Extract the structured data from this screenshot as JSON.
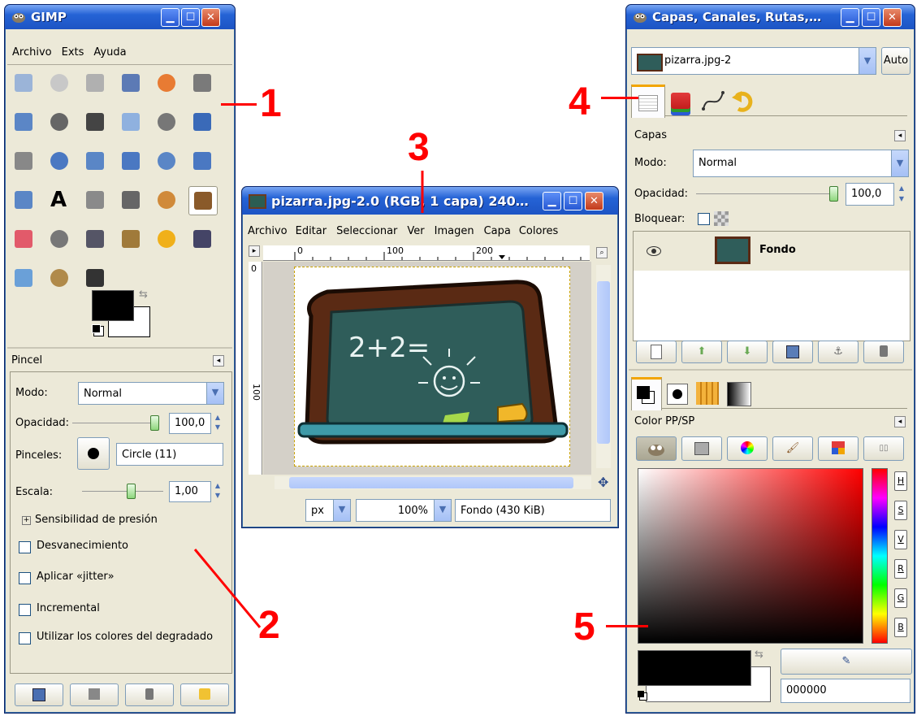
{
  "toolbox": {
    "title": "GIMP",
    "menu": [
      "Archivo",
      "Exts",
      "Ayuda"
    ],
    "tools": [
      "rect-select",
      "ellipse-select",
      "free-select",
      "fuzzy-select",
      "color-select",
      "scissors",
      "foreground-select",
      "paths",
      "color-picker",
      "zoom",
      "measure",
      "move",
      "align",
      "crop",
      "rotate",
      "scale",
      "shear",
      "perspective",
      "flip",
      "text",
      "bucket-fill",
      "blend",
      "pencil",
      "paintbrush",
      "eraser",
      "airbrush",
      "ink",
      "clone",
      "heal",
      "perspective-clone",
      "blur",
      "smudge",
      "dodge-burn"
    ],
    "fg_color": "#000000",
    "bg_color": "#ffffff"
  },
  "tool_options": {
    "title": "Pincel",
    "mode_label": "Modo:",
    "mode_value": "Normal",
    "opacity_label": "Opacidad:",
    "opacity_value": "100,0",
    "opacity_level": 1.0,
    "brushes_label": "Pinceles:",
    "brush_name": "Circle (11)",
    "scale_label": "Escala:",
    "scale_value": "1,00",
    "pressure": "Sensibilidad de presión",
    "checks": [
      "Desvanecimiento",
      "Aplicar «jitter»",
      "Incremental",
      "Utilizar los colores del degradado"
    ]
  },
  "image_window": {
    "title": "pizarra.jpg-2.0 (RGB, 1 capa) 240…",
    "menu": [
      "Archivo",
      "Editar",
      "Seleccionar",
      "Ver",
      "Imagen",
      "Capa",
      "Colores"
    ],
    "ruler_top": [
      "0",
      "100",
      "200"
    ],
    "ruler_left": [
      "0",
      "100"
    ],
    "canvas_text": "2+2=",
    "unit": "px",
    "zoom": "100%",
    "status": "Fondo (430 KiB)"
  },
  "layers_dock": {
    "title": "Capas, Canales, Rutas,…",
    "image_select": "pizarra.jpg-2",
    "auto_label": "Auto",
    "panel_title": "Capas",
    "mode_label": "Modo:",
    "mode_value": "Normal",
    "opacity_label": "Opacidad:",
    "opacity_value": "100,0",
    "lock_label": "Bloquear:",
    "layer_name": "Fondo"
  },
  "color_dock": {
    "panel_title": "Color PP/SP",
    "channels": [
      "H",
      "S",
      "V",
      "R",
      "G",
      "B"
    ],
    "hex_value": "000000"
  },
  "callouts": [
    "1",
    "2",
    "3",
    "4",
    "5"
  ]
}
